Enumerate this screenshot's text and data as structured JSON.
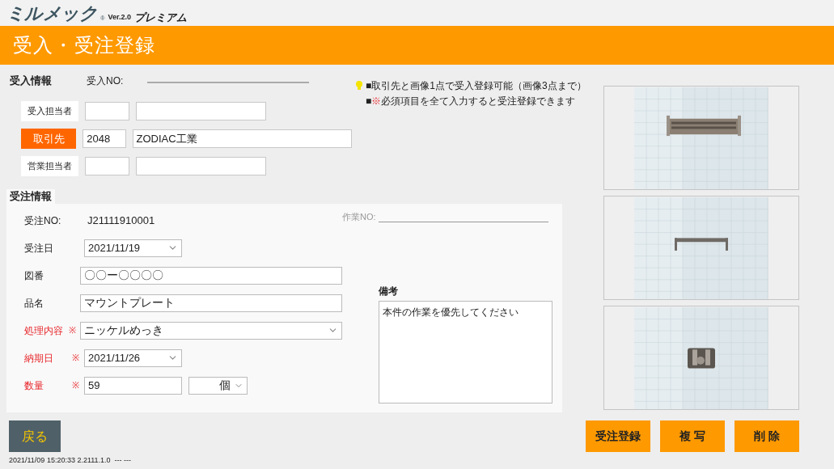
{
  "logo": {
    "name": "ミルメック",
    "registered": "®",
    "version": "Ver.2.0",
    "edition": "プレミアム"
  },
  "title": "受入・受注登録",
  "receive_info": {
    "heading": "受入情報",
    "no_label": "受入NO:",
    "rows": [
      {
        "label": "受入担当者",
        "kind": "plain",
        "code": "",
        "name": ""
      },
      {
        "label": "取引先",
        "kind": "button",
        "code": "2048",
        "name": "ZODIAC工業"
      },
      {
        "label": "営業担当者",
        "kind": "plain",
        "code": "",
        "name": ""
      }
    ]
  },
  "hints": [
    {
      "prefix": "■",
      "text": "取引先と画像1点で受入登録可能（画像3点まで）"
    },
    {
      "prefix": "■",
      "mark": "※",
      "text": "必須項目を全て入力すると受注登録できます"
    }
  ],
  "order_info": {
    "heading": "受注情報",
    "fields": [
      {
        "label": "受注NO:",
        "kind": "text",
        "required": false,
        "value": "J21111910001"
      },
      {
        "label": "受注日",
        "kind": "date",
        "required": false,
        "value": "2021/11/19"
      },
      {
        "label": "図番",
        "kind": "input",
        "required": false,
        "value": "〇〇ー〇〇〇〇"
      },
      {
        "label": "品名",
        "kind": "input",
        "required": false,
        "value": "マウントプレート"
      },
      {
        "label": "処理内容",
        "kind": "select",
        "required": true,
        "mark": "※",
        "value": "ニッケルめっき"
      },
      {
        "label": "納期日",
        "kind": "date",
        "required": true,
        "mark": "※",
        "value": "2021/11/26"
      },
      {
        "label": "数量",
        "kind": "quantity",
        "required": true,
        "mark": "※",
        "value": "59",
        "unit": "個"
      }
    ],
    "work_no_label": "作業NO:",
    "remarks": {
      "label": "備考",
      "value": "本件の作業を優先してください"
    }
  },
  "footer": {
    "back": "戻る",
    "status": "2021/11/09 15:20:33 2.2111.1.0  --- ---",
    "actions": [
      "受注登録",
      "複 写",
      "削 除"
    ]
  }
}
